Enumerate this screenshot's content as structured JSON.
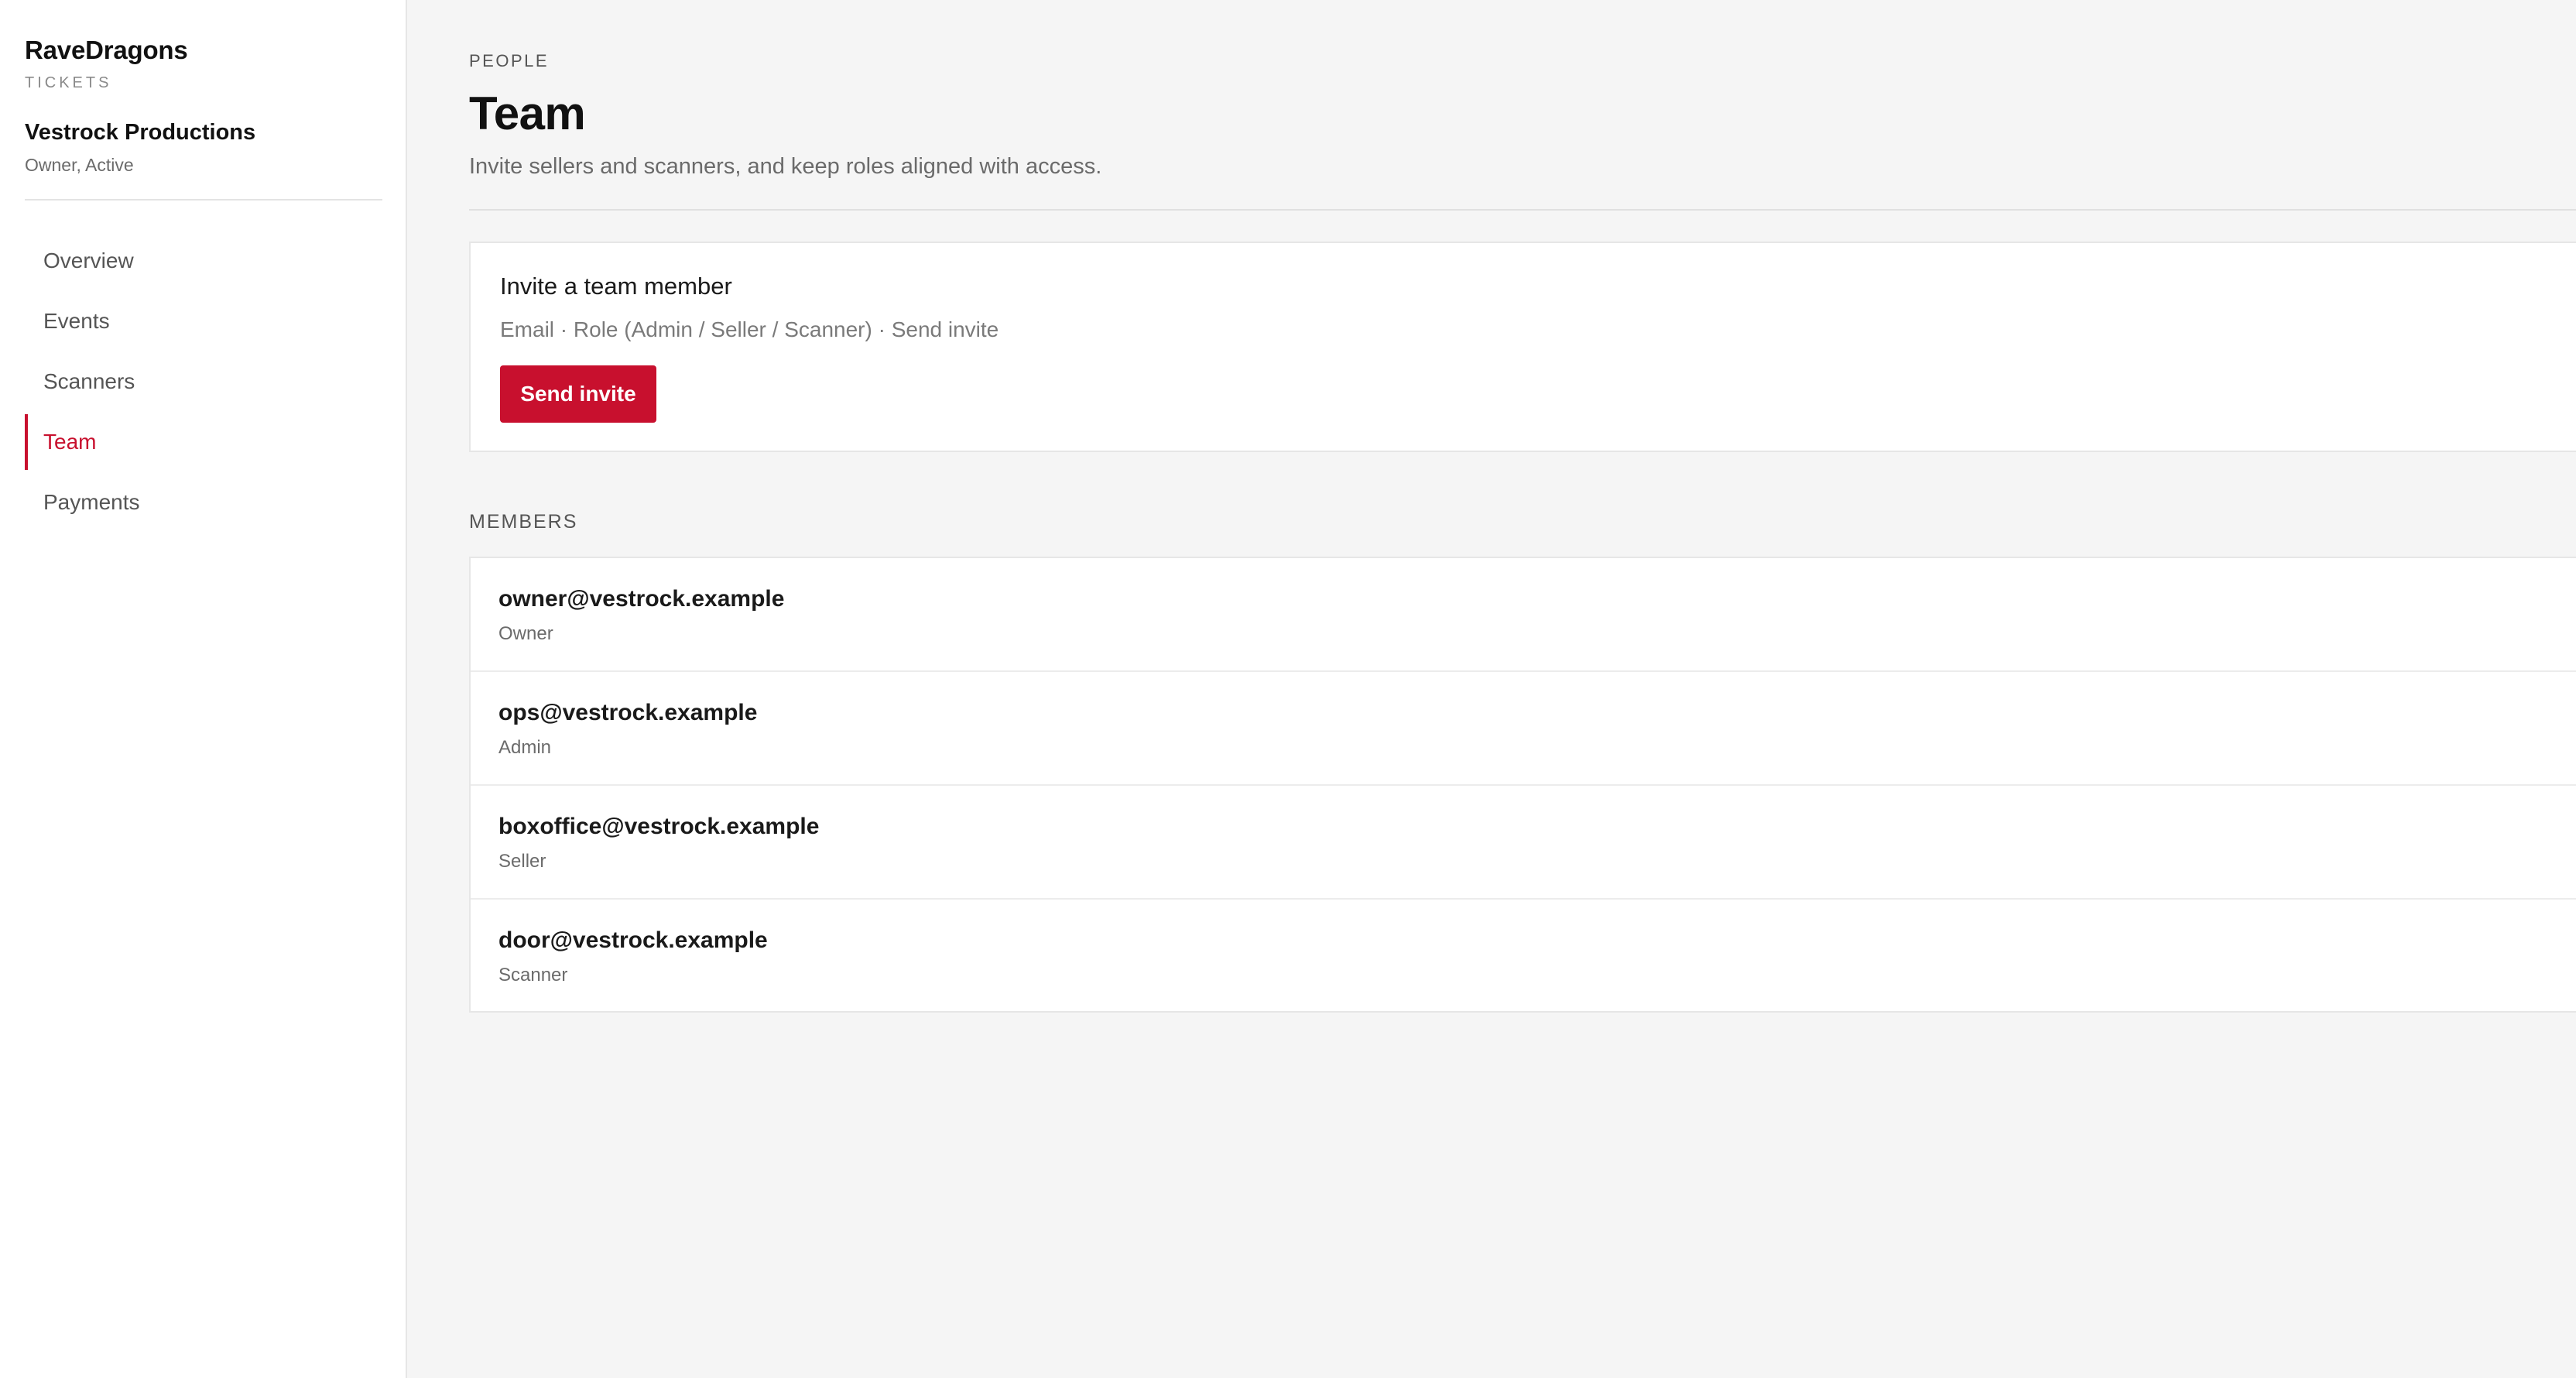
{
  "brand": {
    "name": "RaveDragons",
    "product": "TICKETS"
  },
  "org": {
    "name": "Vestrock Productions",
    "status": "Owner, Active"
  },
  "nav": {
    "items": [
      {
        "label": "Overview",
        "active": false
      },
      {
        "label": "Events",
        "active": false
      },
      {
        "label": "Scanners",
        "active": false
      },
      {
        "label": "Team",
        "active": true
      },
      {
        "label": "Payments",
        "active": false
      }
    ]
  },
  "header": {
    "eyebrow": "PEOPLE",
    "title": "Team",
    "description": "Invite sellers and scanners, and keep roles aligned with access."
  },
  "invite": {
    "title": "Invite a team member",
    "hint": "Email · Role (Admin / Seller / Scanner) · Send invite",
    "button_label": "Send invite"
  },
  "members": {
    "section_label": "MEMBERS",
    "list": [
      {
        "email": "owner@vestrock.example",
        "role": "Owner"
      },
      {
        "email": "ops@vestrock.example",
        "role": "Admin"
      },
      {
        "email": "boxoffice@vestrock.example",
        "role": "Seller"
      },
      {
        "email": "door@vestrock.example",
        "role": "Scanner"
      }
    ]
  },
  "colors": {
    "accent": "#c8102e",
    "background": "#f5f5f5",
    "surface": "#ffffff"
  }
}
